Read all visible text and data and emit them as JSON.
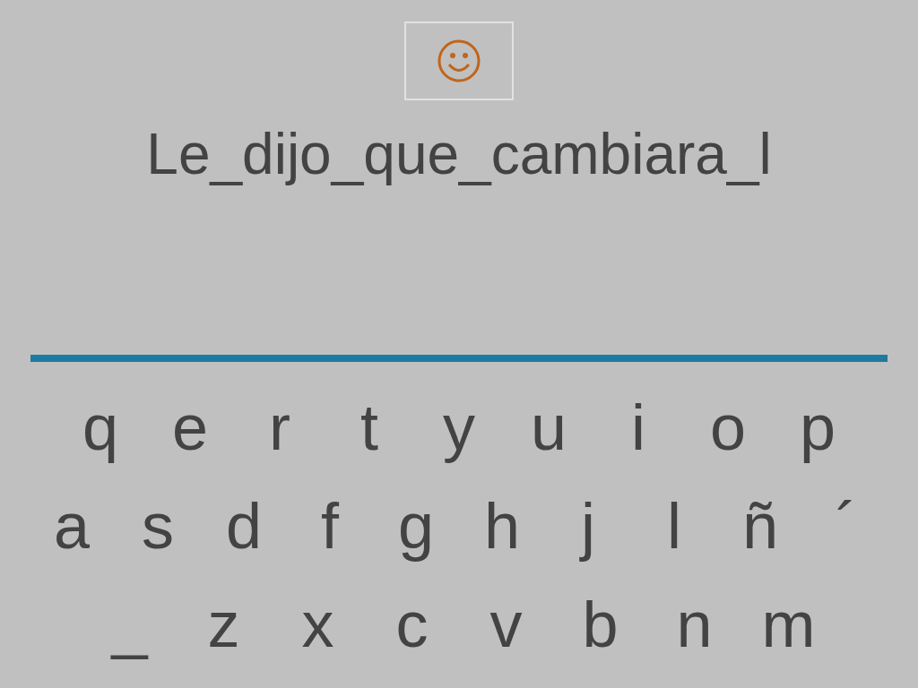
{
  "sentence": "Le_dijo_que_cambiara_l",
  "keyboard": {
    "rows": [
      [
        "q",
        "e",
        "r",
        "t",
        "y",
        "u",
        "i",
        "o",
        "p"
      ],
      [
        "a",
        "s",
        "d",
        "f",
        "g",
        "h",
        "j",
        "l",
        "ñ",
        "´"
      ],
      [
        "_",
        "z",
        "x",
        "c",
        "v",
        "b",
        "n",
        "m"
      ]
    ]
  }
}
